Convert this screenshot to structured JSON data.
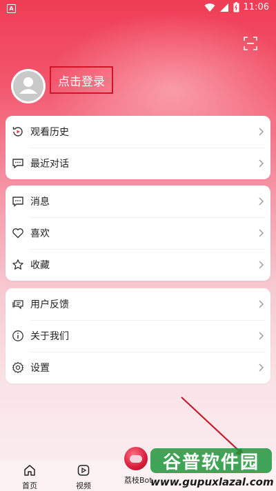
{
  "status_bar": {
    "time": "11:06",
    "app_icon_letter": "A"
  },
  "profile": {
    "login_label": "点击登录"
  },
  "card1": {
    "items": [
      {
        "label": "观看历史",
        "icon": "history-icon"
      },
      {
        "label": "最近对话",
        "icon": "chat-icon"
      }
    ]
  },
  "card2": {
    "items": [
      {
        "label": "消息",
        "icon": "message-icon"
      },
      {
        "label": "喜欢",
        "icon": "heart-icon"
      },
      {
        "label": "收藏",
        "icon": "star-icon"
      }
    ]
  },
  "card3": {
    "items": [
      {
        "label": "用户反馈",
        "icon": "feedback-icon"
      },
      {
        "label": "关于我们",
        "icon": "info-icon"
      },
      {
        "label": "设置",
        "icon": "gear-icon"
      }
    ]
  },
  "tabbar": {
    "home": "首页",
    "video": "视频",
    "lychee": "荔枝Bot"
  },
  "watermark": {
    "title": "谷普软件园",
    "url": "www.gupuxlazal.com"
  },
  "colors": {
    "brand": "#ef3d55",
    "highlight_box": "#d21426"
  }
}
